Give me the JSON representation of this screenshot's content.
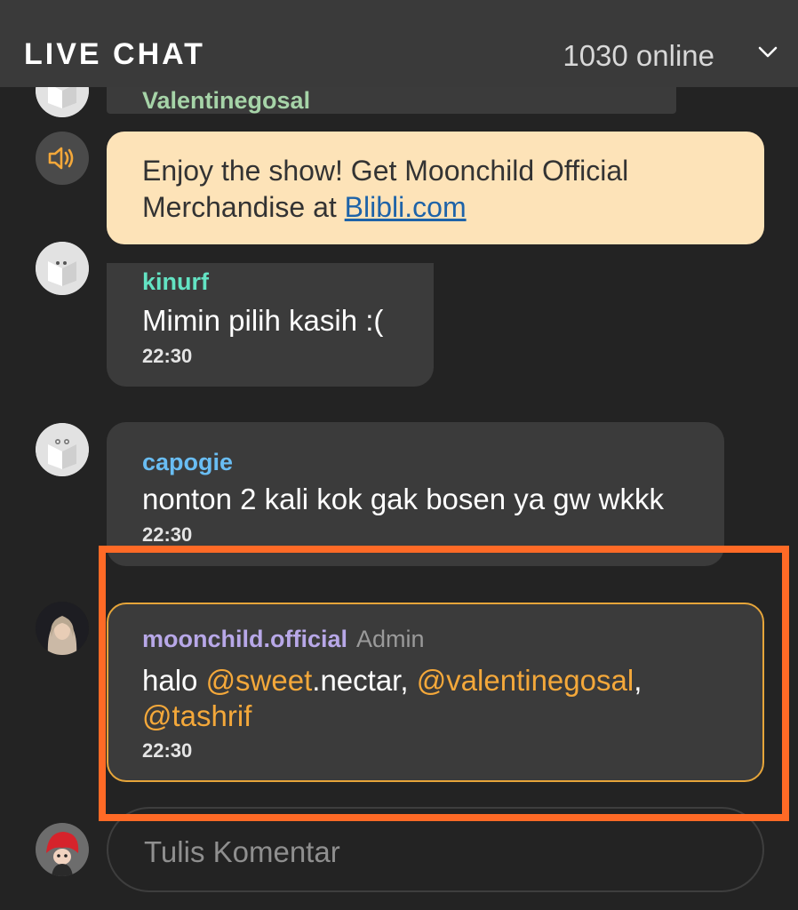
{
  "header": {
    "title": "LIVE CHAT",
    "online": "1030 online",
    "collapse_icon": "chevron-down-icon"
  },
  "partial_message": {
    "username": "Valentinegosal"
  },
  "announcement": {
    "icon": "speaker-icon",
    "text_before": "Enjoy the show! Get Moonchild Official Merchandise at ",
    "link": "Blibli.com"
  },
  "messages": [
    {
      "username": "kinurf",
      "text": "Mimin pilih kasih :(",
      "time": "22:30",
      "name_color": "#63e3c3"
    },
    {
      "username": "capogie",
      "text": "nonton 2 kali kok gak bosen ya gw wkkk",
      "time": "22:30",
      "name_color": "#69bdf3"
    }
  ],
  "admin_message": {
    "username": "moonchild.official",
    "role": "Admin",
    "name_color": "#b8a8e8",
    "text_1": "halo ",
    "mention_1": "@sweet",
    "text_2": ".nectar, ",
    "mention_2": "@valentinegosal",
    "text_3": ",",
    "mention_3": "@tashrif",
    "time": "22:30"
  },
  "composer": {
    "placeholder": "Tulis Komentar"
  }
}
